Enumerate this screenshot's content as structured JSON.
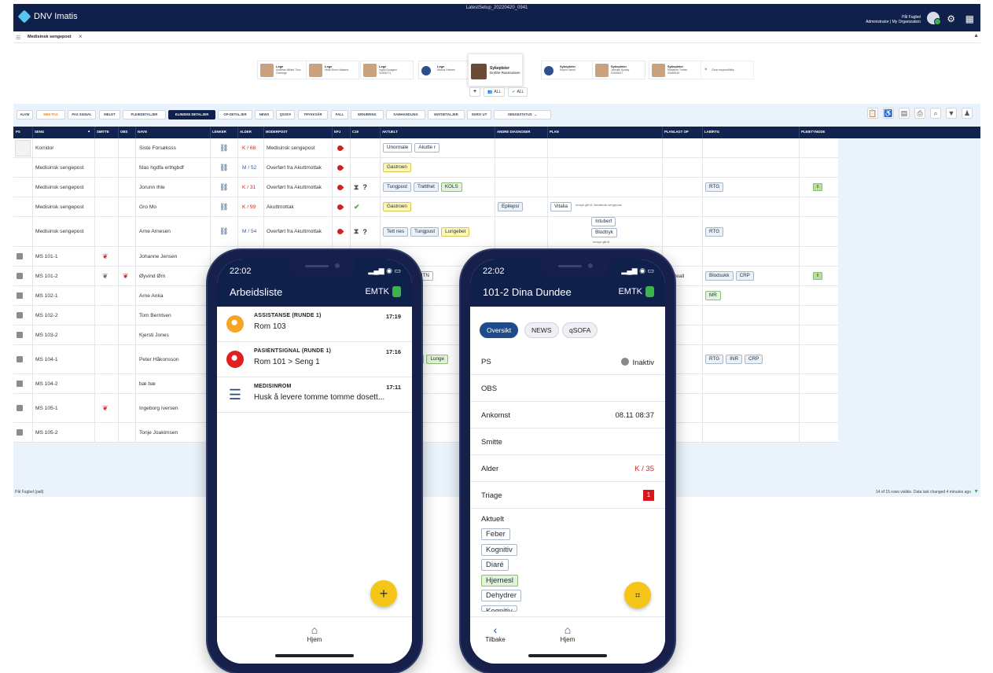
{
  "topbar": {
    "brand": "DNV Imatis",
    "setup": "LatestSetup_20220420_0941",
    "user_name": "Pål Fugbel",
    "user_org": "Administrator | My Organization"
  },
  "tab": {
    "label": "Medisinsk sengepost"
  },
  "staff": {
    "cards": [
      {
        "role": "Lege",
        "name": "Andreas Mikkel Thuv",
        "number": "Overlege",
        "extra": "40035671"
      },
      {
        "role": "Lege",
        "name": "Hilde Bonn Haføresi",
        "number": ""
      },
      {
        "role": "Lege",
        "name": "Ingrid Guagard",
        "number": "92451071"
      },
      {
        "role": "Lege",
        "name": "Marius Holmes",
        "number": ""
      },
      {
        "role": "Sykepleier",
        "name": "Dorthe Rasmussen",
        "number": ""
      },
      {
        "role": "Sykepleier",
        "name": "Espen Særdi",
        "number": ""
      },
      {
        "role": "Sykepleier",
        "name": "Jørmøe Nyrady",
        "number": "93925647"
      },
      {
        "role": "Sykepleier",
        "name": "Marianne Tveten",
        "number": "93459949"
      },
      {
        "role": "",
        "name": "Clear responsibility",
        "number": ""
      }
    ],
    "buttons": {
      "add": "+",
      "all_staff": "ALL",
      "all_ok": "ALL"
    }
  },
  "toolbar": {
    "buttons": [
      "ALVW",
      "MINI PAS",
      "PAS SIGNAL",
      "MELDT",
      "PLEIEDETALJER",
      "KLINISKE DETALJER",
      "OP-DETALJER",
      "NEWS",
      "QSOFA",
      "TRYKKSÅR",
      "FALL",
      "ERNÆRING",
      "SAMHANDLING",
      "MATDETALJER",
      "SKRIV UT",
      "SENGESTATUS"
    ]
  },
  "grid": {
    "headers": [
      "PS",
      "SENG",
      "SMITTE",
      "OBS",
      "NAVN",
      "LENKER",
      "ALDER",
      "MODERPOST",
      "EPJ",
      "C19",
      "AKTUELT",
      "ANDRE DIAGNOSER",
      "PLAN",
      "PLANLAGT OP",
      "LAB/RTG",
      "PLEIETYNGDE"
    ],
    "rows": [
      {
        "ps": "blank",
        "seng": "Korridor",
        "navn": "Siste Forsøksss",
        "alder": "K / 68",
        "moderpost": "Medisinsk sengepost",
        "aktuelt": [
          [
            "Unormale",
            "w"
          ],
          [
            "Akutte r",
            "w"
          ]
        ],
        "andre": [],
        "plan": [],
        "planlagt": "",
        "lab": [],
        "pleie": ""
      },
      {
        "ps": "",
        "seng": "Medisinsk sengepost",
        "navn": "fdas hgdfa erthgbdf",
        "alder": "M / 52",
        "moderpost": "Overført fra Akuttmottak",
        "aktuelt": [
          [
            "Gastroen",
            "y"
          ]
        ],
        "andre": [],
        "plan": [],
        "planlagt": "",
        "lab": [],
        "pleie": ""
      },
      {
        "ps": "",
        "seng": "Medisinsk sengepost",
        "navn": "Jorunn Ihle",
        "alder": "K / 31",
        "moderpost": "Overført fra Akuttmottak",
        "c19": "? ",
        "aktuelt": [
          [
            "Tungpust",
            "b"
          ],
          [
            "Trøtthet",
            "b"
          ],
          [
            "KOLS",
            "g"
          ]
        ],
        "andre": [],
        "plan": [],
        "planlagt": "",
        "lab": [
          [
            "RTG",
            "b"
          ]
        ],
        "pleie": "II"
      },
      {
        "ps": "",
        "seng": "Medisinsk sengepost",
        "navn": "Gro Mo",
        "alder": "K / 99",
        "moderpost": "Akuttmottak",
        "c19": "✓",
        "aktuelt": [
          [
            "Gastroen",
            "y"
          ]
        ],
        "andre": [
          [
            "Epilepsi",
            "b"
          ]
        ],
        "plan": [
          [
            "Vitalia",
            "w"
          ]
        ],
        "plan_note": "Innsyn gitt til: Medisinsk sengepost",
        "planlagt": "",
        "lab": [],
        "pleie": ""
      },
      {
        "ps": "",
        "seng": "Medisinsk sengepost",
        "navn": "Arne Arnesen",
        "alder": "M / 54",
        "moderpost": "Overført fra Akuttmottak",
        "c19": "?",
        "aktuelt": [
          [
            "Tett nes",
            "b"
          ],
          [
            "Tungpust",
            "b"
          ],
          [
            "Lungebet",
            "y"
          ]
        ],
        "andre": [],
        "plan": [
          [
            "Intubert",
            "w"
          ],
          [
            "Blodtryk",
            "w"
          ]
        ],
        "plan_note": "Innsyn gitt til",
        "planlagt": "",
        "lab": [
          [
            "RTG",
            "b"
          ]
        ],
        "pleie": ""
      },
      {
        "ps": "sq",
        "seng": "MS 101-1",
        "smitte": "lungs",
        "navn": "Johanne Jensen",
        "alder": "",
        "moderpost": "",
        "aktuelt": [],
        "andre": [],
        "plan": [],
        "planlagt": "",
        "lab": [],
        "pleie": ""
      },
      {
        "ps": "sq",
        "seng": "MS 101-2",
        "smitte": "lungs-grey",
        "obs": "lungs",
        "navn": "Øyvind Ørn",
        "alder": "",
        "moderpost": "",
        "aktuelt": [
          [
            "HTN",
            "w"
          ]
        ],
        "andre": [],
        "plan": [],
        "planlagt": "Hofteall",
        "lab": [
          [
            "Blodsukk",
            "b"
          ],
          [
            "CRP",
            "b"
          ]
        ],
        "pleie": "II"
      },
      {
        "ps": "sq",
        "seng": "MS 102-1",
        "navn": "Arne Anka",
        "alder": "",
        "moderpost": "",
        "aktuelt": [],
        "andre": [],
        "plan": [],
        "planlagt": "",
        "lab": [
          [
            "MR",
            "g"
          ]
        ],
        "pleie": ""
      },
      {
        "ps": "sq",
        "seng": "MS 102-2",
        "navn": "Tom Berntsen",
        "alder": "",
        "moderpost": "",
        "aktuelt": [],
        "andre": [],
        "plan": [],
        "planlagt": "",
        "lab": [],
        "pleie": ""
      },
      {
        "ps": "sq",
        "seng": "MS 103-2",
        "navn": "Kjersti Jones",
        "alder": "",
        "moderpost": "",
        "aktuelt": [],
        "andre": [],
        "plan": [],
        "planlagt": "",
        "lab": [],
        "pleie": ""
      },
      {
        "ps": "sq",
        "seng": "MS 104-1",
        "navn": "Peter Håkonsson",
        "alder": "",
        "moderpost": "",
        "aktuelt": [
          [
            "Feber",
            "w"
          ],
          [
            "Lunge",
            "g"
          ]
        ],
        "andre": [],
        "plan": [],
        "planlagt": "",
        "lab": [
          [
            "RTG",
            "b"
          ],
          [
            "INR",
            "b"
          ],
          [
            "CRP",
            "b"
          ]
        ],
        "pleie": ""
      },
      {
        "ps": "sq",
        "seng": "MS 104-2",
        "navn": "bæ bæ",
        "alder": "",
        "moderpost": "",
        "aktuelt": [],
        "andre": [],
        "plan": [],
        "planlagt": "",
        "lab": [],
        "pleie": ""
      },
      {
        "ps": "sq",
        "seng": "MS 105-1",
        "smitte": "lungs",
        "navn": "Ingeborg Iversen",
        "alder": "",
        "moderpost": "",
        "aktuelt": [
          [
            "psis",
            "g"
          ]
        ],
        "andre": [],
        "plan": [],
        "planlagt": "",
        "lab": [],
        "pleie": ""
      },
      {
        "ps": "sq",
        "seng": "MS 105-2",
        "navn": "Tonje Joakimsen",
        "alder": "",
        "moderpost": "",
        "aktuelt": [],
        "andre": [],
        "plan": [],
        "planlagt": "",
        "lab": [],
        "pleie": ""
      }
    ]
  },
  "status": {
    "left": "Pål Fugbel (pall)",
    "right": "14 of 15 rows visible. Data last changed 4 minutes ago"
  },
  "phone1": {
    "time": "22:02",
    "title": "Arbeidsliste",
    "unit": "EMTK",
    "tasks": [
      {
        "category": "ASSISTANSE (RUNDE 1)",
        "message": "Rom 103",
        "time": "17:19",
        "color": "#f5a623"
      },
      {
        "category": "PASIENTSIGNAL (RUNDE 1)",
        "message": "Rom 101 > Seng 1",
        "time": "17:16",
        "color": "#e02020"
      },
      {
        "category": "MEDISINROM",
        "message": "Husk å levere tomme tomme dosett...",
        "time": "17:11",
        "color": "list"
      }
    ],
    "fab": "+",
    "nav_home": "Hjem"
  },
  "phone2": {
    "time": "22:02",
    "title": "101-2 Dina Dundee",
    "unit": "EMTK",
    "tabs": [
      "Oversikt",
      "NEWS",
      "qSOFA"
    ],
    "fields": [
      {
        "label": "PS",
        "value": "Inaktiv"
      },
      {
        "label": "OBS",
        "value": ""
      },
      {
        "label": "Ankomst",
        "value": "08.11 08:37"
      },
      {
        "label": "Smitte",
        "value": ""
      },
      {
        "label": "Alder",
        "value": "K / 35"
      },
      {
        "label": "Triage",
        "value": "1"
      }
    ],
    "aktuelt_label": "Aktuelt",
    "aktuelt": [
      [
        "Feber",
        "w"
      ],
      [
        "Kognitiv",
        "w"
      ],
      [
        "Diaré",
        "w"
      ],
      [
        "Hjernesl",
        "g"
      ],
      [
        "Dehydrer",
        "w"
      ],
      [
        "Kognitiv",
        "w"
      ]
    ],
    "nav_back": "Tilbake",
    "nav_home": "Hjem"
  }
}
